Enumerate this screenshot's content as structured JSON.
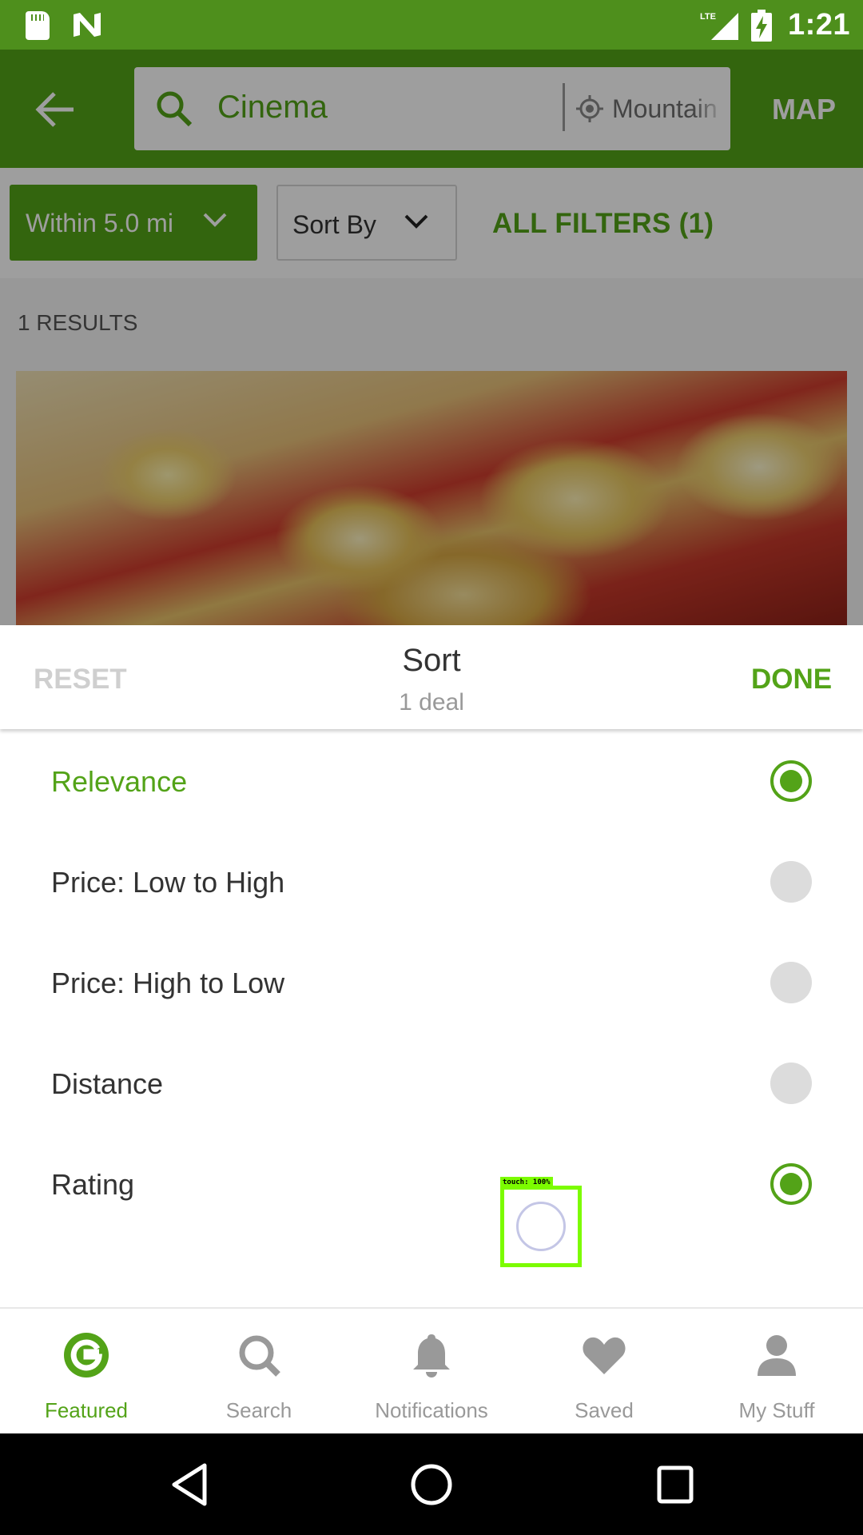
{
  "status_bar": {
    "time": "1:21",
    "network": "LTE",
    "icons": [
      "sd-card-icon",
      "n-logo-icon",
      "lte-signal-icon",
      "battery-charging-icon"
    ]
  },
  "app_bar": {
    "back_icon": "arrow-left-icon",
    "search_icon": "search-icon",
    "query": "Cinema",
    "location_icon": "location-target-icon",
    "location": "Mountain View",
    "map_label": "MAP",
    "brand_color": "#53a318"
  },
  "filters": {
    "distance_label": "Within 5.0 mi",
    "sort_label": "Sort By",
    "all_filters_label": "ALL FILTERS (1)"
  },
  "results": {
    "count_label": "1 RESULTS",
    "card_image": "popcorn-photo"
  },
  "sort_sheet": {
    "reset_label": "RESET",
    "title": "Sort",
    "subtitle": "1 deal",
    "done_label": "DONE",
    "options": [
      {
        "label": "Relevance",
        "selected": true
      },
      {
        "label": "Price: Low to High",
        "selected": false
      },
      {
        "label": "Price: High to Low",
        "selected": false
      },
      {
        "label": "Distance",
        "selected": false
      },
      {
        "label": "Rating",
        "selected": true
      }
    ]
  },
  "touch_indicator": {
    "label": "touch: 100%"
  },
  "bottom_nav": {
    "items": [
      {
        "label": "Featured",
        "icon": "groupon-g-icon",
        "active": true
      },
      {
        "label": "Search",
        "icon": "search-icon",
        "active": false
      },
      {
        "label": "Notifications",
        "icon": "bell-icon",
        "active": false
      },
      {
        "label": "Saved",
        "icon": "heart-icon",
        "active": false
      },
      {
        "label": "My Stuff",
        "icon": "person-icon",
        "active": false
      }
    ]
  },
  "system_nav": {
    "icons": [
      "back-triangle-icon",
      "home-circle-icon",
      "recents-square-icon"
    ]
  }
}
